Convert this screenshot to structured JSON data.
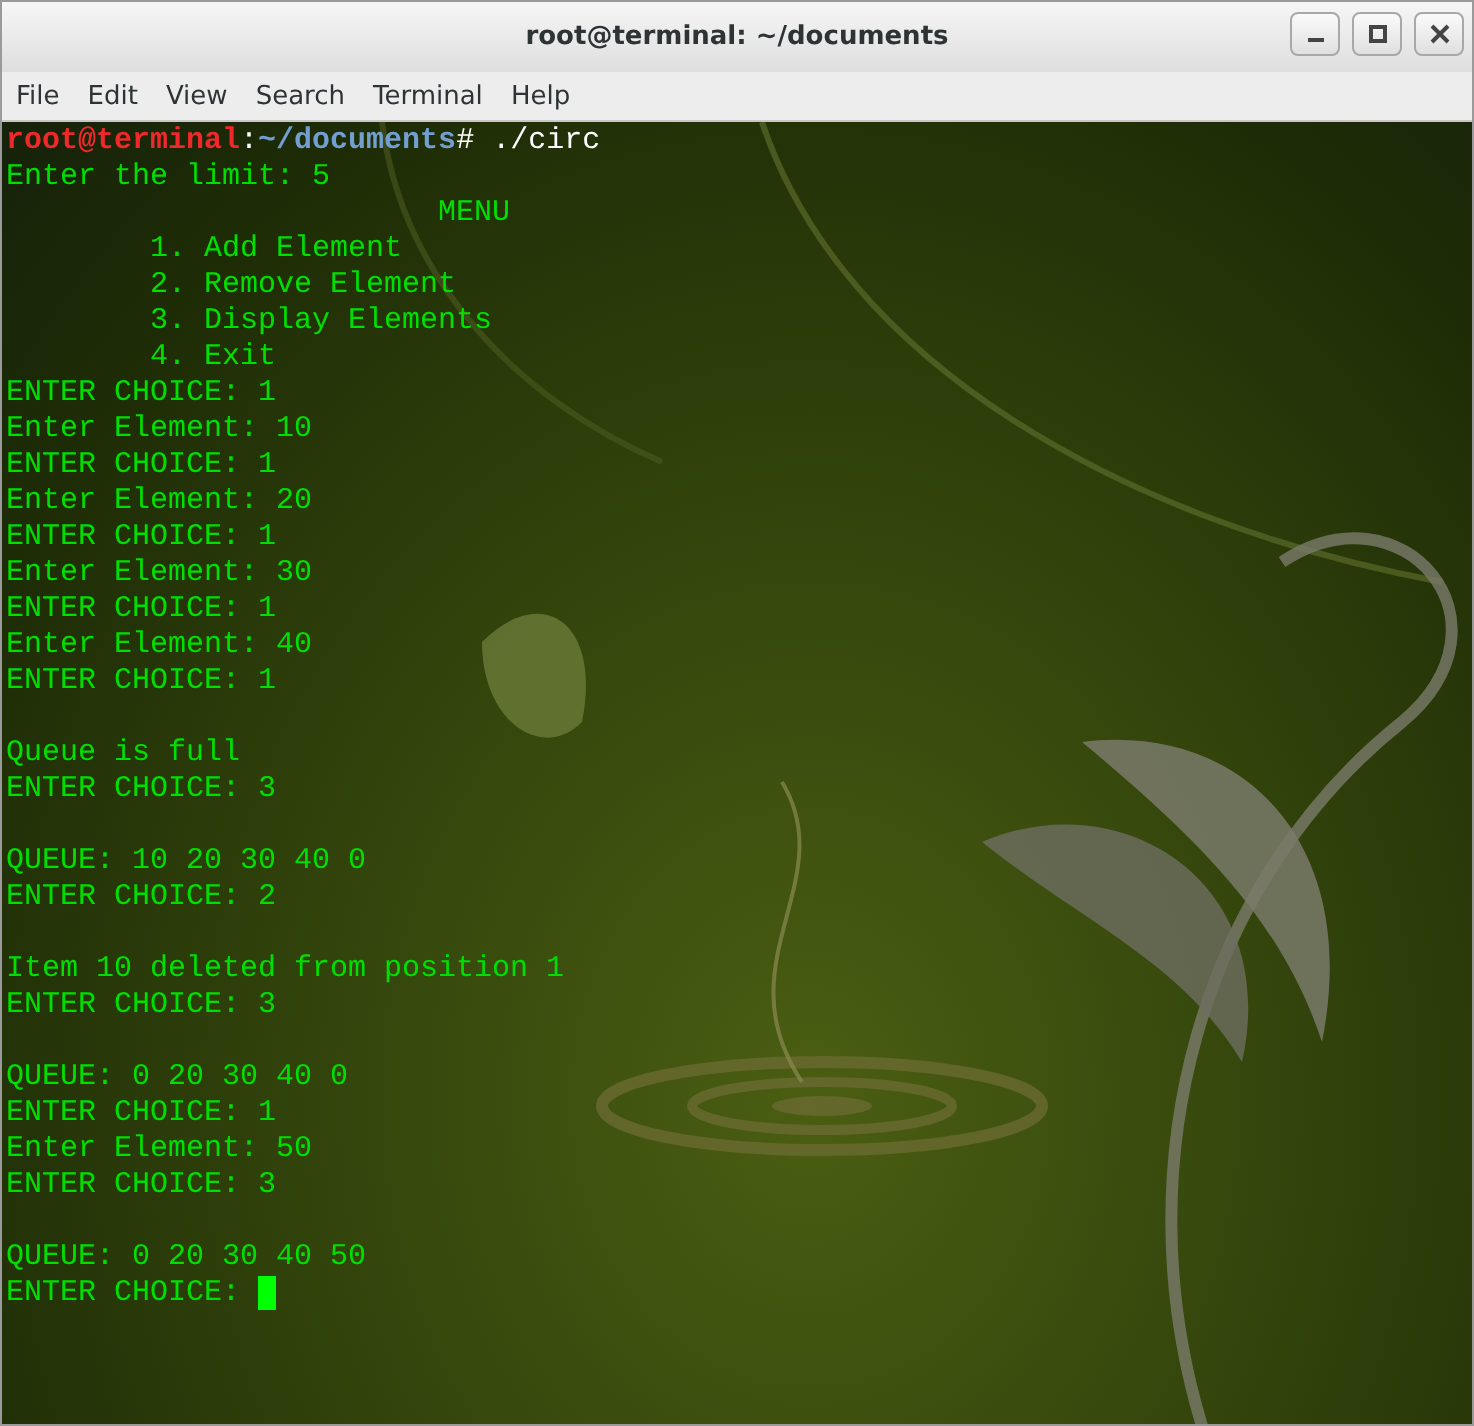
{
  "window": {
    "title": "root@terminal: ~/documents"
  },
  "menu": [
    "File",
    "Edit",
    "View",
    "Search",
    "Terminal",
    "Help"
  ],
  "prompt": {
    "user_host": "root@terminal",
    "separator": ":",
    "path": "~/documents",
    "symbol": "#",
    "command": "./circ"
  },
  "lines": [
    {
      "kind": "output",
      "text": "Enter the limit: 5"
    },
    {
      "kind": "menu-title",
      "text": "MENU"
    },
    {
      "kind": "menu-item",
      "text": "1. Add Element"
    },
    {
      "kind": "menu-item",
      "text": "2. Remove Element"
    },
    {
      "kind": "menu-item",
      "text": "3. Display Elements"
    },
    {
      "kind": "menu-item",
      "text": "4. Exit"
    },
    {
      "kind": "output",
      "text": "ENTER CHOICE: 1"
    },
    {
      "kind": "output",
      "text": "Enter Element: 10"
    },
    {
      "kind": "output",
      "text": "ENTER CHOICE: 1"
    },
    {
      "kind": "output",
      "text": "Enter Element: 20"
    },
    {
      "kind": "output",
      "text": "ENTER CHOICE: 1"
    },
    {
      "kind": "output",
      "text": "Enter Element: 30"
    },
    {
      "kind": "output",
      "text": "ENTER CHOICE: 1"
    },
    {
      "kind": "output",
      "text": "Enter Element: 40"
    },
    {
      "kind": "output",
      "text": "ENTER CHOICE: 1"
    },
    {
      "kind": "blank"
    },
    {
      "kind": "output",
      "text": "Queue is full"
    },
    {
      "kind": "output",
      "text": "ENTER CHOICE: 3"
    },
    {
      "kind": "blank"
    },
    {
      "kind": "output",
      "text": "QUEUE: 10 20 30 40 0"
    },
    {
      "kind": "output",
      "text": "ENTER CHOICE: 2"
    },
    {
      "kind": "blank"
    },
    {
      "kind": "output",
      "text": "Item 10 deleted from position 1"
    },
    {
      "kind": "output",
      "text": "ENTER CHOICE: 3"
    },
    {
      "kind": "blank"
    },
    {
      "kind": "output",
      "text": "QUEUE: 0 20 30 40 0"
    },
    {
      "kind": "output",
      "text": "ENTER CHOICE: 1"
    },
    {
      "kind": "output",
      "text": "Enter Element: 50"
    },
    {
      "kind": "output",
      "text": "ENTER CHOICE: 3"
    },
    {
      "kind": "blank"
    },
    {
      "kind": "output",
      "text": "QUEUE: 0 20 30 40 50"
    },
    {
      "kind": "input",
      "text": "ENTER CHOICE:"
    }
  ]
}
